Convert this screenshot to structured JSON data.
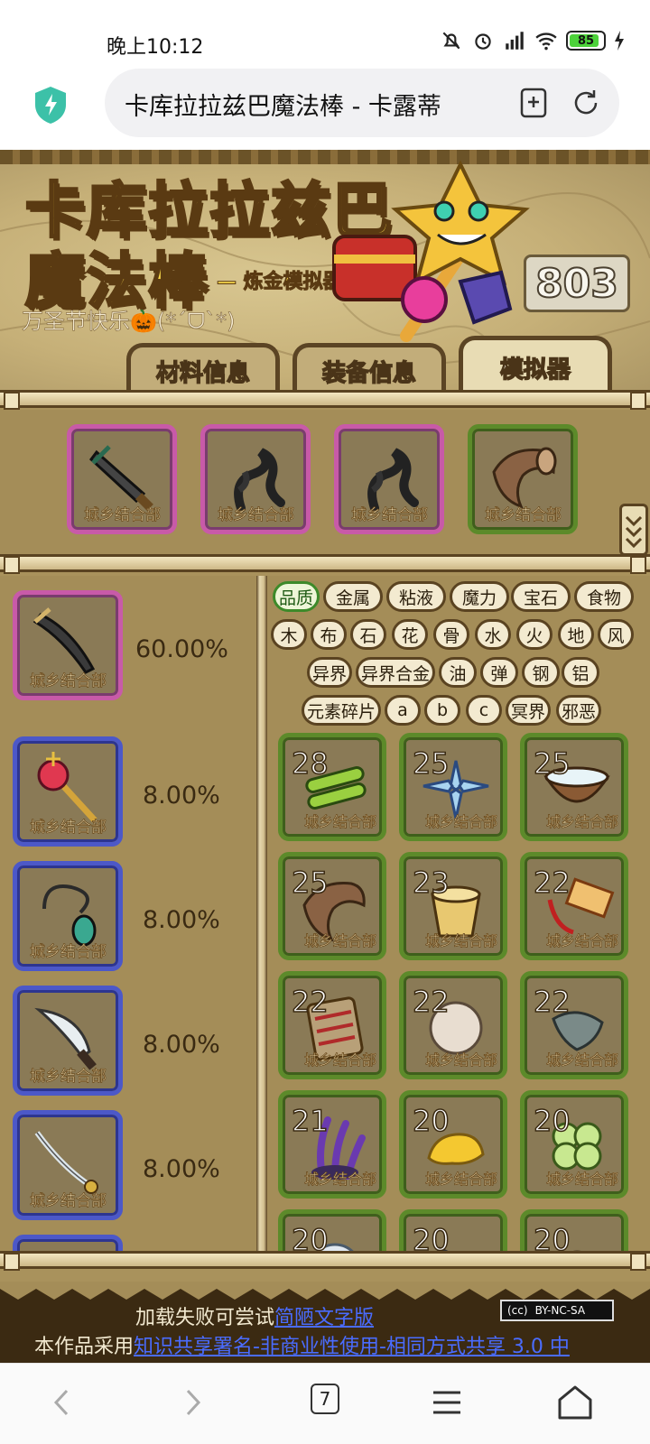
{
  "status_bar": {
    "time": "晚上10:12",
    "battery": "85"
  },
  "browser": {
    "url_title": "卡库拉拉兹巴魔法棒 - 卡露蒂",
    "tab_count": "7"
  },
  "banner": {
    "title_line1": "卡库拉拉兹巴",
    "title_line2": "魔法棒",
    "subtitle": "— 炼金模拟器",
    "holiday_text": "万圣节快乐🎃(*ˊᗜˋ*)",
    "counter": "803"
  },
  "tabs": [
    {
      "label": "材料信息",
      "active": false
    },
    {
      "label": "装备信息",
      "active": false
    },
    {
      "label": "模拟器",
      "active": true
    }
  ],
  "equipped": [
    {
      "icon": "greatsword-icon",
      "frame": "pink"
    },
    {
      "icon": "shadow-tentacle-icon",
      "frame": "pink"
    },
    {
      "icon": "shadow-tentacle-icon",
      "frame": "pink"
    },
    {
      "icon": "horn-icon",
      "frame": "green"
    }
  ],
  "watermark": "城乡结合部",
  "outcomes": [
    {
      "icon": "curved-sword-icon",
      "frame": "pink",
      "chance": "60.00%"
    },
    {
      "icon": "royal-scepter-icon",
      "frame": "blue",
      "chance": "8.00%"
    },
    {
      "icon": "beetle-whip-icon",
      "frame": "blue",
      "chance": "8.00%"
    },
    {
      "icon": "machete-icon",
      "frame": "blue",
      "chance": "8.00%"
    },
    {
      "icon": "saber-icon",
      "frame": "blue",
      "chance": "8.00%"
    }
  ],
  "filters": [
    [
      "品质",
      "金属",
      "粘液",
      "魔力",
      "宝石",
      "食物"
    ],
    [
      "木",
      "布",
      "石",
      "花",
      "骨",
      "水",
      "火",
      "地",
      "风"
    ],
    [
      "异界",
      "异界合金",
      "油",
      "弹",
      "钢",
      "铝"
    ],
    [
      "元素碎片",
      "a",
      "b",
      "c",
      "冥界",
      "邪恶"
    ]
  ],
  "selected_filter": "品质",
  "materials": [
    {
      "count": "28",
      "icon": "bamboo-bundle-icon"
    },
    {
      "count": "25",
      "icon": "crystal-flower-icon"
    },
    {
      "count": "25",
      "icon": "water-bowl-icon"
    },
    {
      "count": "25",
      "icon": "horn-icon"
    },
    {
      "count": "23",
      "icon": "wooden-bucket-icon"
    },
    {
      "count": "22",
      "icon": "talisman-tag-icon"
    },
    {
      "count": "22",
      "icon": "bandaged-board-icon"
    },
    {
      "count": "22",
      "icon": "fur-ball-icon"
    },
    {
      "count": "22",
      "icon": "stone-shard-icon"
    },
    {
      "count": "21",
      "icon": "purple-coral-icon"
    },
    {
      "count": "20",
      "icon": "gold-nugget-icon"
    },
    {
      "count": "20",
      "icon": "four-leaf-clover-icon"
    },
    {
      "count": "20",
      "icon": "glass-orb-icon"
    },
    {
      "count": "20",
      "icon": "chainsaw-icon"
    },
    {
      "count": "20",
      "icon": "owl-icon"
    }
  ],
  "footer": {
    "fallback_prefix": "加载失败可尝试",
    "fallback_link": "简陋文字版",
    "license_prefix": "本作品采用",
    "license_link": "知识共享署名-非商业性使用-相同方式共享 3.0 中",
    "cc_badge": "BY-NC-SA"
  },
  "colors": {
    "pink_frame": "#c85aa8",
    "blue_frame": "#4c58c8",
    "green_frame": "#5c8a2a",
    "panel": "#a48d58"
  }
}
